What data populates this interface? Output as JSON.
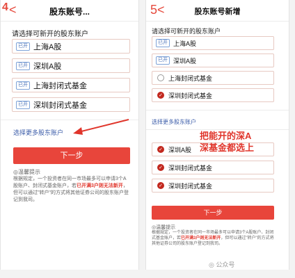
{
  "left": {
    "step": "4",
    "title": "股东账号...",
    "prompt": "请选择可新开的股东账户",
    "options": [
      {
        "tag": "已开",
        "label": "上海A股"
      },
      {
        "tag": "已开",
        "label": "深圳A股"
      },
      {
        "tag": "已开",
        "label": "上海封闭式基金"
      },
      {
        "tag": "已开",
        "label": "深圳封闭式基金"
      }
    ],
    "more_link": "选择更多股东账户",
    "next_button": "下一步",
    "tip_title": "◎温馨提示",
    "tip_part1": "根据规定，一个投资者在同一市场最多可以申请3个A股账户、封闭式基金账户，若",
    "tip_red": "已开满3户则无法新开",
    "tip_part2": "，但可以通过\"转户\"的方式将其他证券公司的股东账户登记到我司。"
  },
  "right": {
    "step": "5",
    "title": "股东账号新增",
    "prompt": "请选择可新开的股东账户",
    "options": [
      {
        "tag": "已开",
        "label": "上海A股"
      },
      {
        "tag": "已开",
        "label": "深圳A股"
      },
      {
        "tag": "",
        "label": "上海封闭式基金",
        "checked": false
      },
      {
        "tag": "",
        "label": "深圳封闭式基金",
        "checked": true
      }
    ],
    "more_link": "选择更多股东账户",
    "more_options": [
      {
        "label": "深圳A股",
        "checked": true
      },
      {
        "label": "深圳封闭式基金",
        "checked": true
      },
      {
        "label": "深圳封闭式基金",
        "checked": true
      }
    ],
    "next_button": "下一步",
    "tip_title": "◎温馨提示",
    "tip_part1": "根据规定，一个投资者在同一市场最多可以申请3个A股账户、封闭式基金账户，若",
    "tip_red": "已开满3户则无法新开",
    "tip_part2": "，但可以通过\"转户\"的方式将其他证券公司的股东账户登记到我司。"
  },
  "annotation": "把能开的深A\n深基金都选上",
  "watermark": "公众号",
  "colors": {
    "accent": "#e8453b",
    "link": "#3a5ba8",
    "checked": "#c2281e"
  }
}
